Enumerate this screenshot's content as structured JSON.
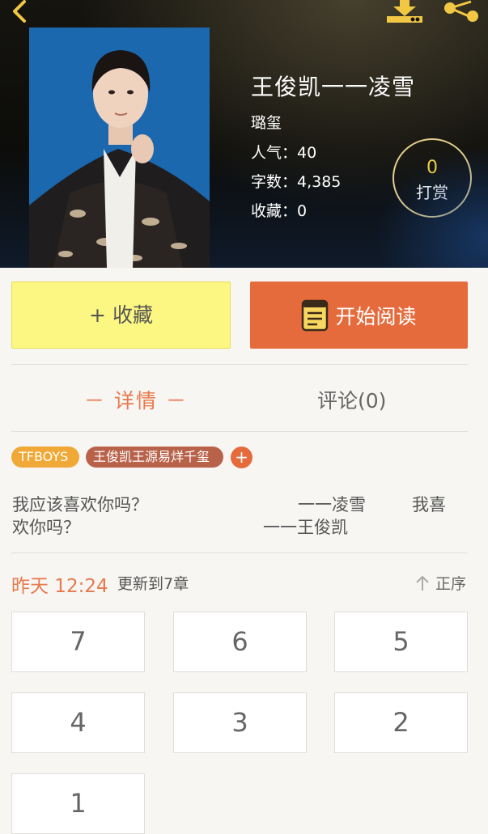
{
  "book": {
    "title": "王俊凯一一凌雪",
    "author": "璐玺",
    "popularity": "人气：40",
    "word_count": "字数：4,385",
    "favorites": "收藏：0"
  },
  "reward": {
    "count": "0",
    "label": "打赏"
  },
  "actions": {
    "favorite_label": "+ 收藏",
    "read_label": "开始阅读"
  },
  "tabs": {
    "detail": "－ 详情 －",
    "comments": "评论(0)"
  },
  "tags": [
    "TFBOYS",
    "王俊凯王源易烊千玺"
  ],
  "tag_add_label": "+",
  "description": {
    "line1_a": "我应该喜欢你吗？",
    "line1_b": "一一凌雪",
    "line1_c": "我喜",
    "line2_a": "欢你吗？",
    "line2_b": "一一王俊凯"
  },
  "update": {
    "time": "昨天 12:24",
    "text": "更新到7章",
    "sort_label": "正序"
  },
  "chapters": [
    "7",
    "6",
    "5",
    "4",
    "3",
    "2",
    "1"
  ],
  "colors": {
    "accent": "#e56b3c",
    "favorite_bg": "#fcf783",
    "detail_tab": "#e8794c",
    "reward_count": "#f5d23c"
  },
  "icons": {
    "back": "back-arrow-icon",
    "download": "download-icon",
    "share": "share-icon",
    "book": "book-icon",
    "sort": "arrow-up-icon"
  }
}
